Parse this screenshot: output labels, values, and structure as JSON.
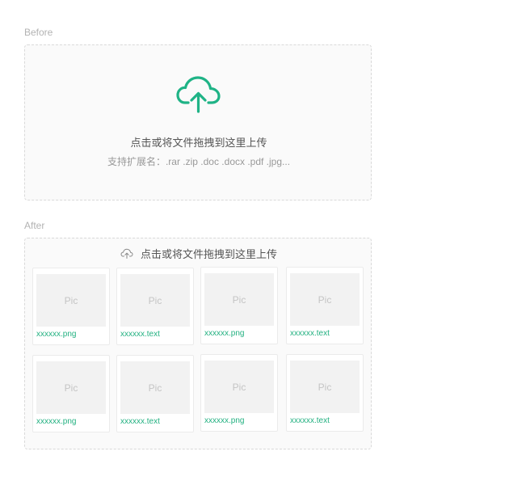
{
  "colors": {
    "accent": "#1fb386",
    "border": "#d9d9d9",
    "thumb_bg": "#f2f2f2"
  },
  "before": {
    "label": "Before",
    "icon": "cloud-upload-icon",
    "prompt": "点击或将文件拖拽到这里上传",
    "hint": "支持扩展名：.rar .zip .doc .docx .pdf .jpg..."
  },
  "after": {
    "label": "After",
    "icon": "cloud-upload-icon",
    "prompt": "点击或将文件拖拽到这里上传",
    "files": [
      {
        "thumb": "Pic",
        "name": "xxxxxx.png"
      },
      {
        "thumb": "Pic",
        "name": "xxxxxx.text"
      },
      {
        "thumb": "Pic",
        "name": "xxxxxx.png"
      },
      {
        "thumb": "Pic",
        "name": "xxxxxx.text"
      },
      {
        "thumb": "Pic",
        "name": "xxxxxx.png"
      },
      {
        "thumb": "Pic",
        "name": "xxxxxx.text"
      },
      {
        "thumb": "Pic",
        "name": "xxxxxx.png"
      },
      {
        "thumb": "Pic",
        "name": "xxxxxx.text"
      }
    ]
  }
}
